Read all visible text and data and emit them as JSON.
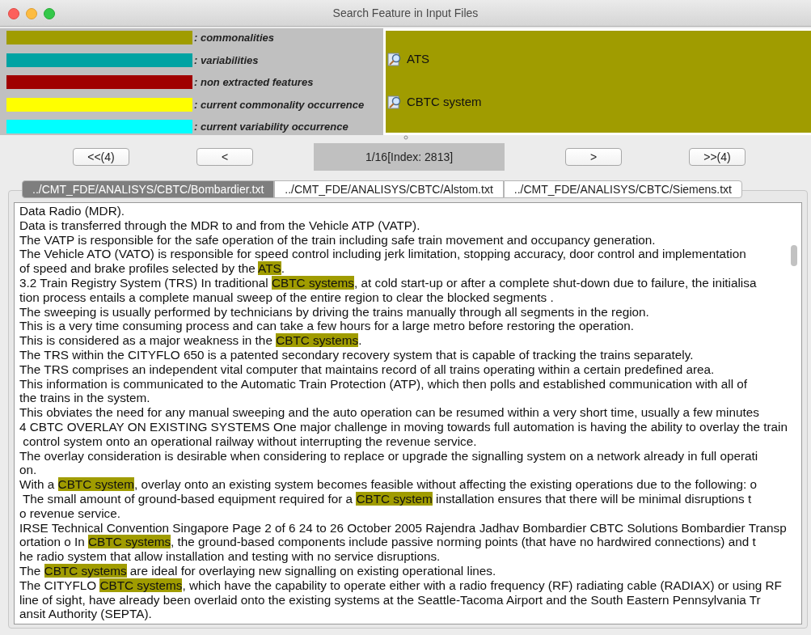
{
  "window": {
    "title": "Search Feature in Input Files"
  },
  "legend": [
    {
      "label": ": commonalities",
      "color": "#a09c00"
    },
    {
      "label": ": variabilities",
      "color": "#00a3a3"
    },
    {
      "label": ": non extracted features",
      "color": "#a00000"
    },
    {
      "label": ": current commonality occurrence",
      "color": "#ffff00"
    },
    {
      "label": ": current variability occurrence",
      "color": "#00ffff"
    }
  ],
  "features": [
    {
      "label": "ATS"
    },
    {
      "label": "CBTC system"
    }
  ],
  "navigation": {
    "first": "<<(4)",
    "previous": "<",
    "position": "1/16[Index: 2813]",
    "next": ">",
    "last": ">>(4)"
  },
  "tabs": [
    {
      "label": "../CMT_FDE/ANALISYS/CBTC/Bombardier.txt",
      "selected": true
    },
    {
      "label": "../CMT_FDE/ANALISYS/CBTC/Alstom.txt",
      "selected": false
    },
    {
      "label": "../CMT_FDE/ANALISYS/CBTC/Siemens.txt",
      "selected": false
    }
  ],
  "lines": [
    [
      {
        "text": "Data Radio (MDR).",
        "highlighted": false
      }
    ],
    [
      {
        "text": "Data is transferred through the MDR to and from the Vehicle ATP (VATP).",
        "highlighted": false
      }
    ],
    [
      {
        "text": "The VATP is responsible for the safe operation of the train including safe train movement and occupancy generation.",
        "highlighted": false
      }
    ],
    [
      {
        "text": "The Vehicle ATO (VATO) is responsible for speed control including jerk limitation, stopping accuracy, door control and implementation",
        "highlighted": false
      }
    ],
    [
      {
        "text": "of speed and brake profiles selected by the ",
        "highlighted": false
      },
      {
        "text": "ATS",
        "highlighted": true
      },
      {
        "text": ".",
        "highlighted": false
      }
    ],
    [
      {
        "text": "3.2 Train Registry System (TRS) In traditional ",
        "highlighted": false
      },
      {
        "text": "CBTC systems",
        "highlighted": true
      },
      {
        "text": ", at cold start-up or after a complete shut-down due to failure, the initialisa",
        "highlighted": false
      }
    ],
    [
      {
        "text": "tion process entails a complete manual sweep of the entire region to clear the blocked segments .",
        "highlighted": false
      }
    ],
    [
      {
        "text": "The sweeping is usually performed by technicians by driving the trains manually through all segments in the region.",
        "highlighted": false
      }
    ],
    [
      {
        "text": "This is a very time consuming process and can take a few hours for a large metro before restoring the operation.",
        "highlighted": false
      }
    ],
    [
      {
        "text": "This is considered as a major weakness in the ",
        "highlighted": false
      },
      {
        "text": "CBTC systems",
        "highlighted": true
      },
      {
        "text": ".",
        "highlighted": false
      }
    ],
    [
      {
        "text": "The TRS within the CITYFLO 650 is a patented secondary recovery system that is capable of tracking the trains separately.",
        "highlighted": false
      }
    ],
    [
      {
        "text": "The TRS comprises an independent vital computer that maintains record of all trains operating within a certain predefined area.",
        "highlighted": false
      }
    ],
    [
      {
        "text": "This information is communicated to the Automatic Train Protection (ATP), which then polls and established communication with all of",
        "highlighted": false
      }
    ],
    [
      {
        "text": "the trains in the system.",
        "highlighted": false
      }
    ],
    [
      {
        "text": "This obviates the need for any manual sweeping and the auto operation can be resumed within a very short time, usually a few minutes",
        "highlighted": false
      }
    ],
    [
      {
        "text": "4 CBTC OVERLAY ON EXISTING SYSTEMS One major challenge in moving towards full automation is having the ability to overlay the train",
        "highlighted": false
      }
    ],
    [
      {
        "text": " control system onto an operational railway without interrupting the revenue service.",
        "highlighted": false
      }
    ],
    [
      {
        "text": "The overlay consideration is desirable when considering to replace or upgrade the signalling system on a network already in full operati",
        "highlighted": false
      }
    ],
    [
      {
        "text": "on.",
        "highlighted": false
      }
    ],
    [
      {
        "text": "With a ",
        "highlighted": false
      },
      {
        "text": "CBTC system",
        "highlighted": true
      },
      {
        "text": ", overlay onto an existing system becomes feasible without affecting the existing operations due to the following: o",
        "highlighted": false
      }
    ],
    [
      {
        "text": " The small amount of ground-based equipment required for a ",
        "highlighted": false
      },
      {
        "text": "CBTC system",
        "highlighted": true
      },
      {
        "text": " installation ensures that there will be minimal disruptions t",
        "highlighted": false
      }
    ],
    [
      {
        "text": "o revenue service.",
        "highlighted": false
      }
    ],
    [
      {
        "text": "IRSE Technical Convention Singapore Page 2 of 6 24 to 26 October 2005 Rajendra Jadhav Bombardier CBTC Solutions Bombardier Transp",
        "highlighted": false
      }
    ],
    [
      {
        "text": "ortation o In ",
        "highlighted": false
      },
      {
        "text": "CBTC systems",
        "highlighted": true
      },
      {
        "text": ", the ground-based components include passive norming points (that have no hardwired connections) and t",
        "highlighted": false
      }
    ],
    [
      {
        "text": "he radio system that allow installation and testing with no service disruptions.",
        "highlighted": false
      }
    ],
    [
      {
        "text": "The ",
        "highlighted": false
      },
      {
        "text": "CBTC systems",
        "highlighted": true
      },
      {
        "text": " are ideal for overlaying new signalling on existing operational lines.",
        "highlighted": false
      }
    ],
    [
      {
        "text": "The CITYFLO ",
        "highlighted": false
      },
      {
        "text": "CBTC systems",
        "highlighted": true
      },
      {
        "text": ", which have the capability to operate either with a radio frequency (RF) radiating cable (RADIAX) or using RF",
        "highlighted": false
      }
    ],
    [
      {
        "text": "line of sight, have already been overlaid onto the existing systems at the Seattle-Tacoma Airport and the South Eastern Pennsylvania Tr",
        "highlighted": false
      }
    ],
    [
      {
        "text": "ansit Authority (SEPTA).",
        "highlighted": false
      }
    ]
  ]
}
